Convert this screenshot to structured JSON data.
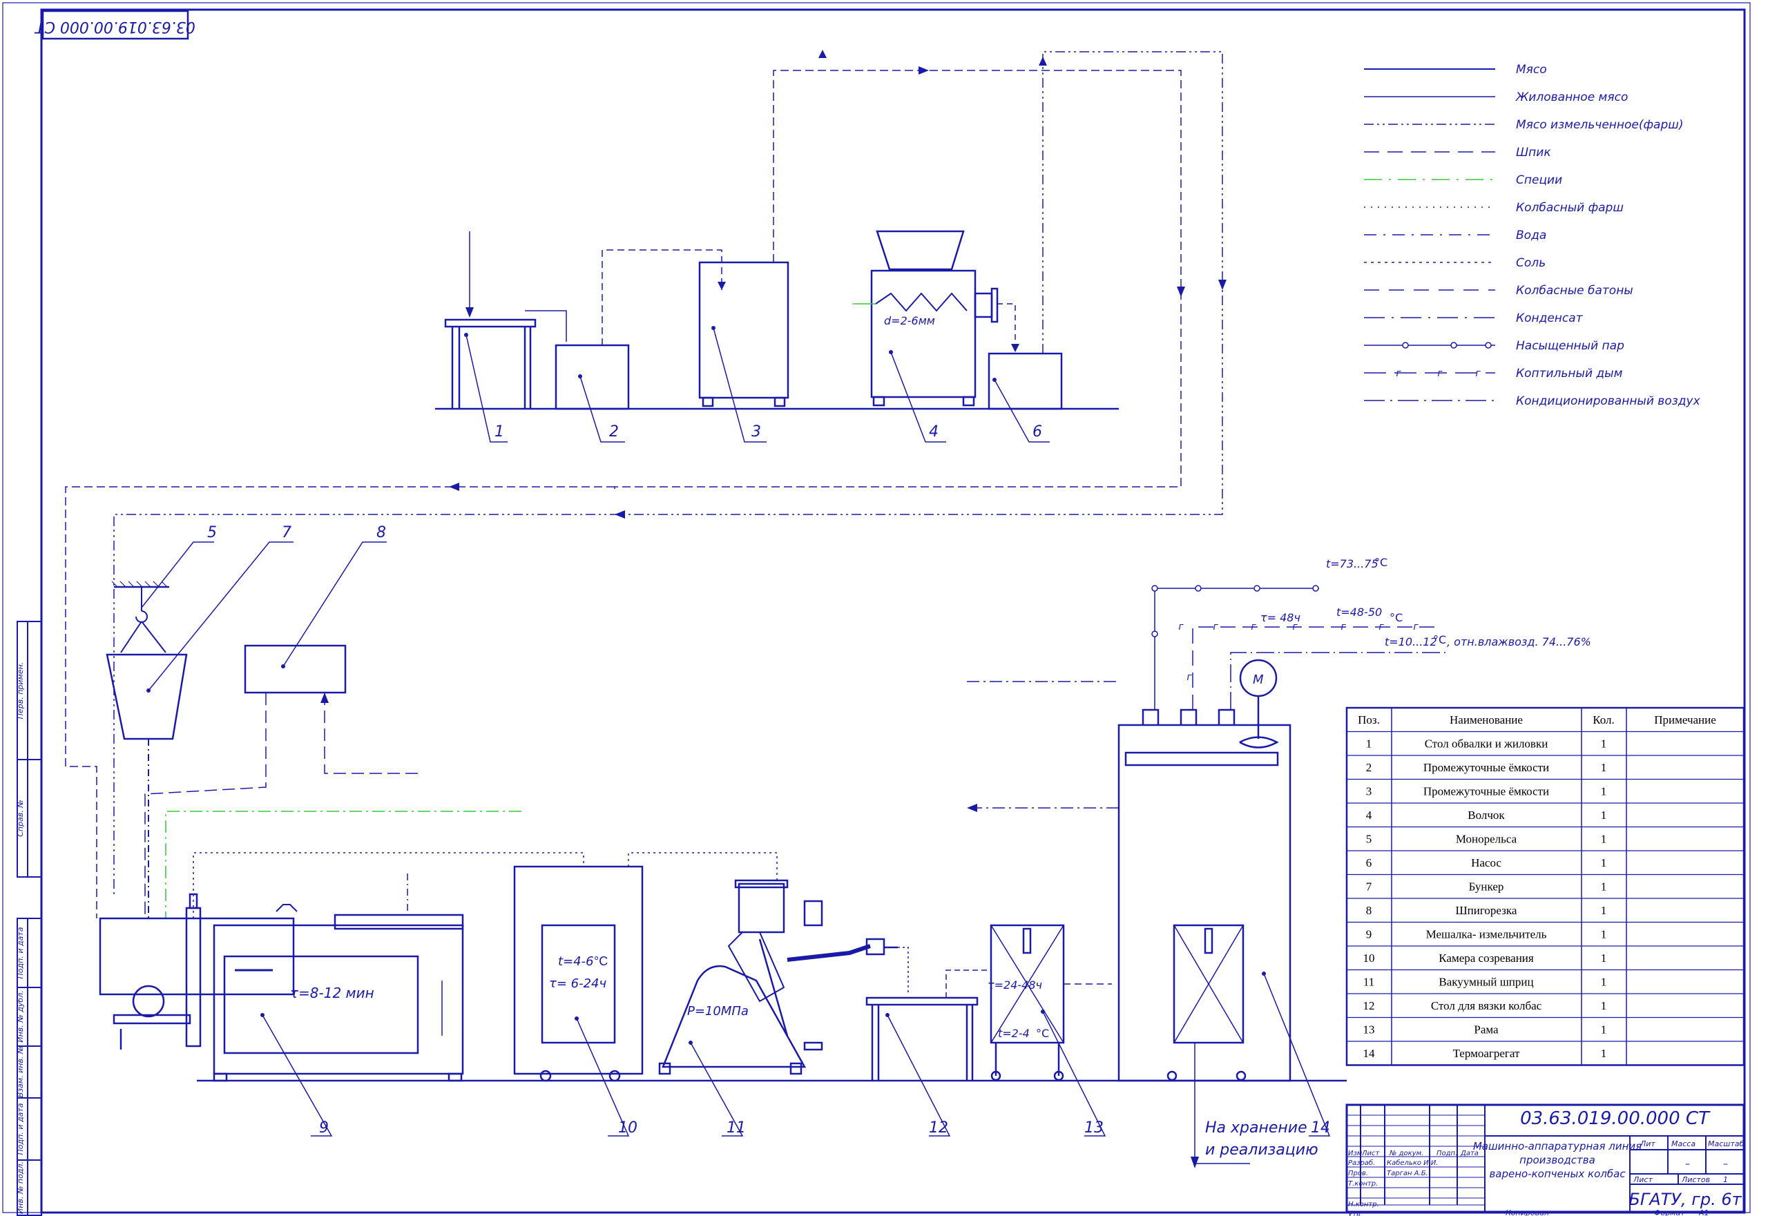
{
  "stamp_code_rotated": "03.63.019.00.000 СТ",
  "legend": [
    {
      "label": "Мясо",
      "style": "solid",
      "color": "#1a1aa8"
    },
    {
      "label": "Жилованное мясо",
      "style": "solid-thin",
      "color": "#1a1aa8"
    },
    {
      "label": "Мясо измельченное(фарш)",
      "style": "dash-dot-dot",
      "color": "#1a1aa8"
    },
    {
      "label": "Шпик",
      "style": "long-dash",
      "color": "#1a1aa8"
    },
    {
      "label": "Специи",
      "style": "dash-dot-green",
      "color": "#33cc33"
    },
    {
      "label": "Колбасный фарш",
      "style": "dotted",
      "color": "#1a1aa8"
    },
    {
      "label": "Вода",
      "style": "dash-dot",
      "color": "#1a1aa8"
    },
    {
      "label": "Соль",
      "style": "short-dot",
      "color": "#1a1aa8"
    },
    {
      "label": "Колбасные батоны",
      "style": "dashed",
      "color": "#1a1aa8"
    },
    {
      "label": "Конденсат",
      "style": "dash-dot-long",
      "color": "#1a1aa8"
    },
    {
      "label": "Насыщенный пар",
      "style": "circles",
      "color": "#1a1aa8"
    },
    {
      "label": "Коптильный дым",
      "style": "gas",
      "color": "#1a1aa8"
    },
    {
      "label": "Кондиционированный воздух",
      "style": "crosses",
      "color": "#1a1aa8"
    }
  ],
  "equipment_numbers": [
    "1",
    "2",
    "3",
    "4",
    "6",
    "5",
    "7",
    "8",
    "9",
    "10",
    "11",
    "12",
    "13",
    "14"
  ],
  "annotations": {
    "grinder_d": "d=2-6мм",
    "mixer_time": "τ=8-12 мин",
    "maturation_temp": "t=4-6",
    "maturation_temp_unit": "°С",
    "maturation_time": "τ= 6-24ч",
    "syringe_pressure": "Р=10МПа",
    "rack_time": "τ=24-48ч",
    "rack_temp": "t=2-4",
    "rack_temp_unit": "°С",
    "steam_temp": "t=73...75",
    "steam_temp_unit": "°С",
    "smoke_time": "τ= 48ч",
    "smoke_temp": "t=48-50",
    "smoke_temp_unit": "°С",
    "air_temp": "t=10...12",
    "air_temp_unit": "°С",
    "air_humidity": ", отн.влажвозд. 74...76%",
    "motor": "М",
    "gas_mark": "г",
    "storage_line1": "На хранение",
    "storage_line2": "и реализацию"
  },
  "spec_table": {
    "headers": [
      "Поз.",
      "Наименование",
      "Кол.",
      "Примечание"
    ],
    "rows": [
      [
        "1",
        "Стол обвалки и жиловки",
        "1",
        ""
      ],
      [
        "2",
        "Промежуточные ёмкости",
        "1",
        ""
      ],
      [
        "3",
        "Промежуточные ёмкости",
        "1",
        ""
      ],
      [
        "4",
        "Волчок",
        "1",
        ""
      ],
      [
        "5",
        "Монорельса",
        "1",
        ""
      ],
      [
        "6",
        "Насос",
        "1",
        ""
      ],
      [
        "7",
        "Бункер",
        "1",
        ""
      ],
      [
        "8",
        "Шпигорезка",
        "1",
        ""
      ],
      [
        "9",
        "Мешалка- измельчитель",
        "1",
        ""
      ],
      [
        "10",
        "Камера созревания",
        "1",
        ""
      ],
      [
        "11",
        "Вакуумный шприц",
        "1",
        ""
      ],
      [
        "12",
        "Стол для вязки колбас",
        "1",
        ""
      ],
      [
        "13",
        "Рама",
        "1",
        ""
      ],
      [
        "14",
        "Термоагрегат",
        "1",
        ""
      ]
    ]
  },
  "title_block": {
    "code": "03.63.019.00.000 СТ",
    "title_l1": "Машинно-аппаратурная линия",
    "title_l2": "производства",
    "title_l3": "варено-копченых колбас",
    "org": "БГАТУ, гр. 6т",
    "lit": "Лит",
    "massa": "Масса",
    "masshtab": "Масштаб",
    "dash1": "–",
    "dash2": "–",
    "list": "Лист",
    "listov": "Листов",
    "listov_val": "1",
    "izm_header": [
      "Изм",
      "Лист",
      "№ докум.",
      "Подп.",
      "Дата"
    ],
    "roles": [
      "Разраб.",
      "Пров.",
      "Т.контр.",
      "",
      "Н.контр.",
      "Утв."
    ],
    "names": [
      "Кабелько И.И.",
      "Тарган А.Б.",
      "",
      "",
      "",
      ""
    ],
    "kopiroval": "Копировал",
    "format": "Формат",
    "format_val": "А1"
  },
  "side_stamp": [
    "Перв. примен.",
    "Справ. №",
    "Подп. и дата",
    "Инв. № дубл.",
    "Взам. инв. №",
    "Подп. и дата",
    "Инв. № подл."
  ]
}
